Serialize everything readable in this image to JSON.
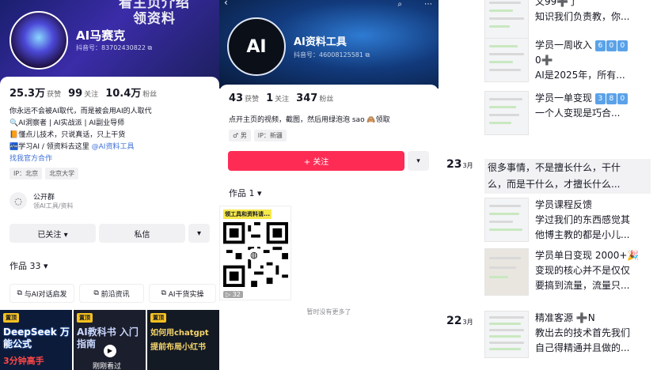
{
  "panel1": {
    "banner_text": "看主页介绍\n领资料",
    "name": "AI马赛克",
    "uid": "抖音号：83702430822",
    "stats": [
      {
        "value": "25.3万",
        "label": "获赞"
      },
      {
        "value": "99",
        "label": "关注"
      },
      {
        "value": "10.4万",
        "label": "粉丝"
      }
    ],
    "bio": [
      "你永远不会被AI取代，而是被会用AI的人取代",
      "🔍AI洞察者 | AI实战派 | AI副业导师",
      "📙懂点儿技术，只说真话，只上干货",
      "🏧学习AI / 领资料去这里 ",
      "找我官方合作"
    ],
    "bio_link": "@AI资料工具",
    "tags": [
      "IP：北京",
      "北京大学"
    ],
    "group_title": "公开群",
    "group_sub": "领AI工具/资料",
    "followed": "已关注 ▾",
    "message": "私信",
    "more": "▾",
    "works": "作品 33 ▾",
    "chips": [
      "与AI对话启发",
      "前沿资讯",
      "AI干货实操"
    ],
    "thumbs": [
      {
        "pin": "置顶",
        "title": "DeepSeek 万能公式",
        "foot": "3分钟高手"
      },
      {
        "pin": "置顶",
        "title": "AI教科书 入门指南",
        "foot": "刚刚看过"
      },
      {
        "pin": "置顶",
        "title": "如何用chatgpt 提前布局小红书",
        "foot": ""
      }
    ]
  },
  "panel2": {
    "name": "AI资料工具",
    "avatar_text": "AI",
    "uid": "抖音号：46008125581",
    "stats": [
      {
        "value": "43",
        "label": "获赞"
      },
      {
        "value": "1",
        "label": "关注"
      },
      {
        "value": "347",
        "label": "粉丝"
      }
    ],
    "bio": "点开主页的视频，截图，然后用绿泡泡 sao 🙈领取",
    "tags": [
      "♂ 男",
      "IP：新疆"
    ],
    "follow": "+ 关注",
    "more": "▾",
    "works": "作品 1 ▾",
    "qr_title": "领工具和资料请...",
    "plays": "▷ 32",
    "no_more": "暂时没有更多了"
  },
  "panel3": {
    "dates": [
      {
        "day": "23",
        "month": "3月"
      },
      {
        "day": "22",
        "month": "3月"
      }
    ],
    "posts": [
      {
        "lines": [
          "又99➕了",
          "知识我们负责教，你..."
        ]
      },
      {
        "lines": [
          "学员一周收入",
          "0➕",
          "AI是2025年，所有..."
        ],
        "digits": [
          "6",
          "0",
          "0"
        ]
      },
      {
        "lines": [
          "学员一单变现",
          "一个人变现是巧合..."
        ],
        "digits": [
          "3",
          "8",
          "0"
        ]
      },
      {
        "lines": [
          "学员课程反馈",
          "学过我们的东西感觉其",
          "他博主教的都是小儿..."
        ]
      },
      {
        "lines": [
          "学员单日变现 2000+🎉",
          "变现的核心并不是仅仅",
          "要搞到流量，流量只..."
        ]
      },
      {
        "lines": [
          "精准客源 ➕N",
          "教出去的技术首先我们",
          "自己得精通并且做的..."
        ]
      }
    ],
    "quote": [
      "很多事情，不是擅长什么，干什",
      "么，而是干什么，才擅长什么..."
    ]
  }
}
